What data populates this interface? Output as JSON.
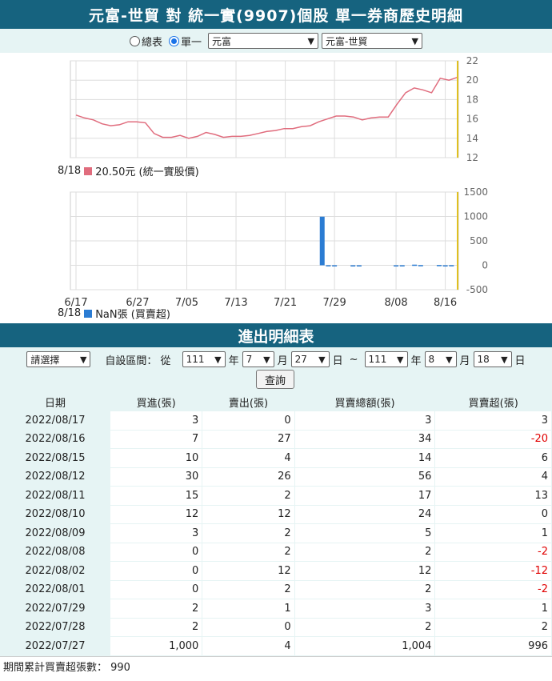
{
  "header": {
    "title": "元富-世貿 對 統一實(9907)個股 單一券商歷史明細"
  },
  "selector": {
    "radio_all": "總表",
    "radio_single": "單一",
    "broker": "元富",
    "branch": "元富-世貿"
  },
  "colors": {
    "header_bg": "#16637f",
    "price_line": "#e06c7d",
    "bar": "#2b7cd3",
    "today_line": "#e0c020"
  },
  "legend_price": {
    "date": "8/18",
    "text": "20.50元 (統一實股價)"
  },
  "legend_bar": {
    "date": "8/18",
    "text": "NaN張 (買賣超)"
  },
  "chart_data": [
    {
      "type": "line",
      "series": [
        {
          "values": [
            16.4,
            16.1,
            15.9,
            15.5,
            15.3,
            15.4,
            15.7,
            15.7,
            15.6,
            14.5,
            14.1,
            14.1,
            14.3,
            14.0,
            14.2,
            14.6,
            14.4,
            14.1,
            14.2,
            14.2,
            14.3,
            14.5,
            14.7,
            14.8,
            15.0,
            15.0,
            15.2,
            15.3,
            15.7,
            16.0,
            16.3,
            16.3,
            16.2,
            15.9,
            16.1,
            16.2,
            16.2,
            17.5,
            18.7,
            19.2,
            19.0,
            18.7,
            20.2,
            20.0,
            20.3
          ]
        }
      ],
      "yticks": [
        12,
        14,
        16,
        18,
        20,
        22
      ],
      "ylim": [
        12,
        22
      ]
    },
    {
      "type": "bar",
      "xticks": [
        "6/17",
        "6/27",
        "7/05",
        "7/13",
        "7/21",
        "7/29",
        "8/08",
        "8/16"
      ],
      "yticks": [
        -500,
        0,
        500,
        1000,
        1500
      ],
      "ylim": [
        -500,
        1500
      ],
      "points": [
        {
          "date": "7/27",
          "value": 996
        },
        {
          "date": "7/28",
          "value": 2
        },
        {
          "date": "7/29",
          "value": 1
        },
        {
          "date": "8/01",
          "value": -2
        },
        {
          "date": "8/02",
          "value": -12
        },
        {
          "date": "8/08",
          "value": -2
        },
        {
          "date": "8/09",
          "value": 1
        },
        {
          "date": "8/10",
          "value": 0
        },
        {
          "date": "8/11",
          "value": 13
        },
        {
          "date": "8/12",
          "value": 4
        },
        {
          "date": "8/15",
          "value": 6
        },
        {
          "date": "8/16",
          "value": -20
        },
        {
          "date": "8/17",
          "value": 3
        }
      ]
    }
  ],
  "detail": {
    "title": "進出明細表"
  },
  "filter": {
    "choose": "請選擇",
    "range_label": "自設區間：  從",
    "from_year": "111",
    "year_label": "年",
    "from_month": "7",
    "month_label": "月",
    "from_day": "27",
    "day_label": "日",
    "tilde": "~",
    "to_year": "111",
    "to_month": "8",
    "to_day": "18",
    "query": "查詢"
  },
  "table": {
    "headers": [
      "日期",
      "買進(張)",
      "賣出(張)",
      "買賣總額(張)",
      "買賣超(張)"
    ],
    "rows": [
      [
        "2022/08/17",
        "3",
        "0",
        "3",
        "3"
      ],
      [
        "2022/08/16",
        "7",
        "27",
        "34",
        "-20"
      ],
      [
        "2022/08/15",
        "10",
        "4",
        "14",
        "6"
      ],
      [
        "2022/08/12",
        "30",
        "26",
        "56",
        "4"
      ],
      [
        "2022/08/11",
        "15",
        "2",
        "17",
        "13"
      ],
      [
        "2022/08/10",
        "12",
        "12",
        "24",
        "0"
      ],
      [
        "2022/08/09",
        "3",
        "2",
        "5",
        "1"
      ],
      [
        "2022/08/08",
        "0",
        "2",
        "2",
        "-2"
      ],
      [
        "2022/08/02",
        "0",
        "12",
        "12",
        "-12"
      ],
      [
        "2022/08/01",
        "0",
        "2",
        "2",
        "-2"
      ],
      [
        "2022/07/29",
        "2",
        "1",
        "3",
        "1"
      ],
      [
        "2022/07/28",
        "2",
        "0",
        "2",
        "2"
      ],
      [
        "2022/07/27",
        "1,000",
        "4",
        "1,004",
        "996"
      ]
    ]
  },
  "footer": {
    "text": "期間累計買賣超張數：  990"
  }
}
